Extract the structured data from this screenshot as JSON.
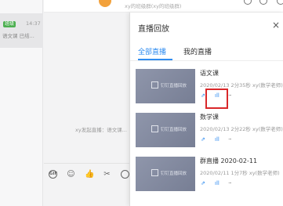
{
  "chat_list": {
    "tag": "班级",
    "time": "14:37",
    "preview": "语文课 已结..."
  },
  "topbar": {
    "group_name": "xy的班级群(xy的班级群)"
  },
  "main": {
    "system_message": "xy发起直播：语文课..."
  },
  "panel": {
    "title": "直播回放",
    "close": "×",
    "tabs": [
      {
        "label": "全部直播",
        "active": true
      },
      {
        "label": "我的直播",
        "active": false
      }
    ],
    "thumb_logo": "钉钉直播回放",
    "items": [
      {
        "title": "语文课",
        "meta": "2020/02/13 2分35秒 xy(数学老师)"
      },
      {
        "title": "数学课",
        "meta": "2020/02/13 2分22秒 xy(数学老师)"
      },
      {
        "title": "群直播 2020-02-11",
        "meta": "2020/02/11 1分7秒 xy(数学老师)"
      }
    ],
    "actions": {
      "share": "⇗",
      "stats": "ıll",
      "more": "···"
    }
  },
  "colors": {
    "accent": "#2f8cf0",
    "highlight": "#d9282a"
  }
}
